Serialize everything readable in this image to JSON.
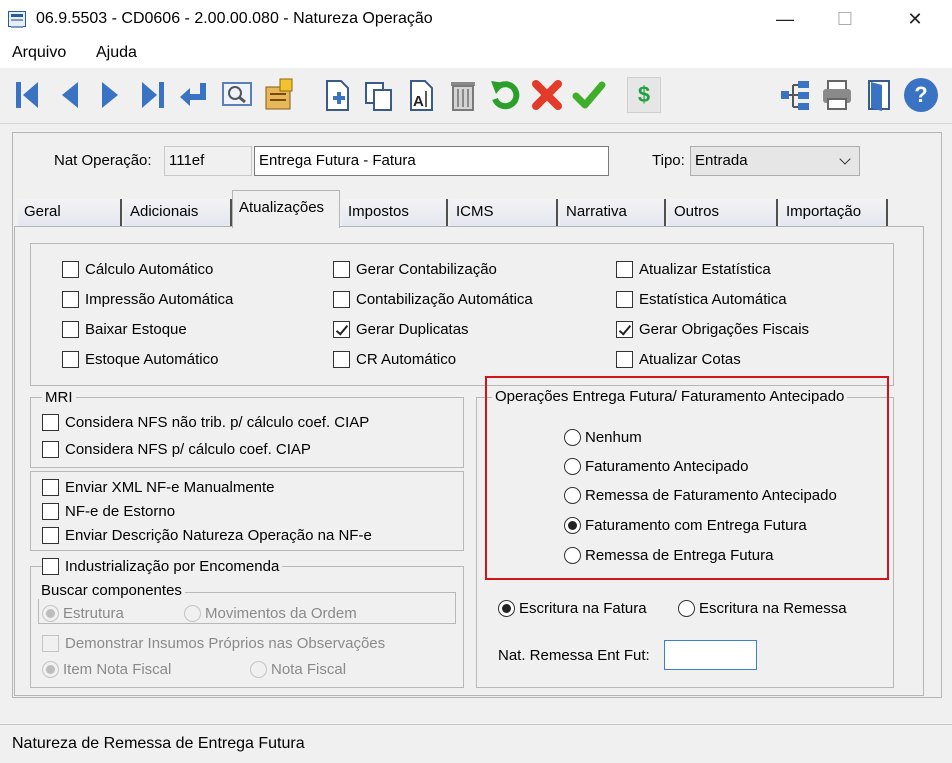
{
  "window": {
    "title": "06.9.5503 - CD0606 - 2.00.00.080 - Natureza Operação",
    "minimize": "—",
    "maximize": "☐",
    "close": "✕"
  },
  "menu": {
    "items": [
      "Arquivo",
      "Ajuda"
    ]
  },
  "toolbar": {
    "icons": [
      "first-icon",
      "prev-icon",
      "next-icon",
      "last-icon",
      "enter-icon",
      "search-icon",
      "notes-icon",
      "new-icon",
      "copy-icon",
      "edit-icon",
      "delete-icon",
      "undo-icon",
      "cancel-icon",
      "confirm-icon",
      "currency-icon",
      "tree-icon",
      "print-icon",
      "exit-icon",
      "help-icon"
    ],
    "currency_glyph": "$",
    "help_glyph": "?"
  },
  "header": {
    "nat_label": "Nat Operação:",
    "nat_code": "111ef",
    "nat_desc": "Entrega Futura - Fatura",
    "tipo_label": "Tipo:",
    "tipo_value": "Entrada"
  },
  "tabs": [
    "Geral",
    "Adicionais",
    "Atualizações",
    "Impostos",
    "ICMS",
    "Narrativa",
    "Outros",
    "Importação"
  ],
  "active_tab": "Atualizações",
  "options": {
    "col1": [
      {
        "label": "Cálculo Automático",
        "checked": false
      },
      {
        "label": "Impressão Automática",
        "checked": false
      },
      {
        "label": "Baixar Estoque",
        "checked": false
      },
      {
        "label": "Estoque Automático",
        "checked": false
      }
    ],
    "col2": [
      {
        "label": "Gerar Contabilização",
        "checked": false
      },
      {
        "label": "Contabilização Automática",
        "checked": false
      },
      {
        "label": "Gerar Duplicatas",
        "checked": true
      },
      {
        "label": "CR Automático",
        "checked": false
      }
    ],
    "col3": [
      {
        "label": "Atualizar Estatística",
        "checked": false
      },
      {
        "label": "Estatística Automática",
        "checked": false
      },
      {
        "label": "Gerar Obrigações Fiscais",
        "checked": true
      },
      {
        "label": "Atualizar Cotas",
        "checked": false
      }
    ]
  },
  "mri": {
    "title": "MRI",
    "items": [
      {
        "label": "Considera NFS não trib. p/ cálculo coef. CIAP",
        "checked": false
      },
      {
        "label": "Considera NFS p/ cálculo coef. CIAP",
        "checked": false
      }
    ]
  },
  "nfe": {
    "items": [
      {
        "label": "Enviar XML NF-e Manualmente",
        "checked": false
      },
      {
        "label": "NF-e de Estorno",
        "checked": false
      },
      {
        "label": "Enviar Descrição Natureza Operação na NF-e",
        "checked": false
      }
    ]
  },
  "industrializacao": {
    "label": "Industrialização por Encomenda",
    "checked": false,
    "buscar_title": "Buscar componentes",
    "buscar_options": [
      {
        "label": "Estrutura",
        "selected": true
      },
      {
        "label": "Movimentos da Ordem",
        "selected": false
      }
    ],
    "demonstrar_label": "Demonstrar Insumos Próprios nas Observações",
    "item_options": [
      {
        "label": "Item Nota Fiscal",
        "selected": true
      },
      {
        "label": "Nota Fiscal",
        "selected": false
      }
    ]
  },
  "entrega_futura": {
    "title": "Operações Entrega Futura/ Faturamento Antecipado",
    "options": [
      {
        "label": "Nenhum",
        "selected": false
      },
      {
        "label": "Faturamento Antecipado",
        "selected": false
      },
      {
        "label": "Remessa de Faturamento Antecipado",
        "selected": false
      },
      {
        "label": "Faturamento com Entrega Futura",
        "selected": true
      },
      {
        "label": "Remessa de Entrega Futura",
        "selected": false
      }
    ],
    "highlight_color": "#d0141c"
  },
  "escritura": {
    "options": [
      {
        "label": "Escritura na Fatura",
        "selected": true
      },
      {
        "label": "Escritura na Remessa",
        "selected": false
      }
    ]
  },
  "remessa": {
    "label": "Nat. Remessa Ent Fut:",
    "value": ""
  },
  "status": {
    "text": "Natureza de Remessa de Entrega Futura"
  }
}
